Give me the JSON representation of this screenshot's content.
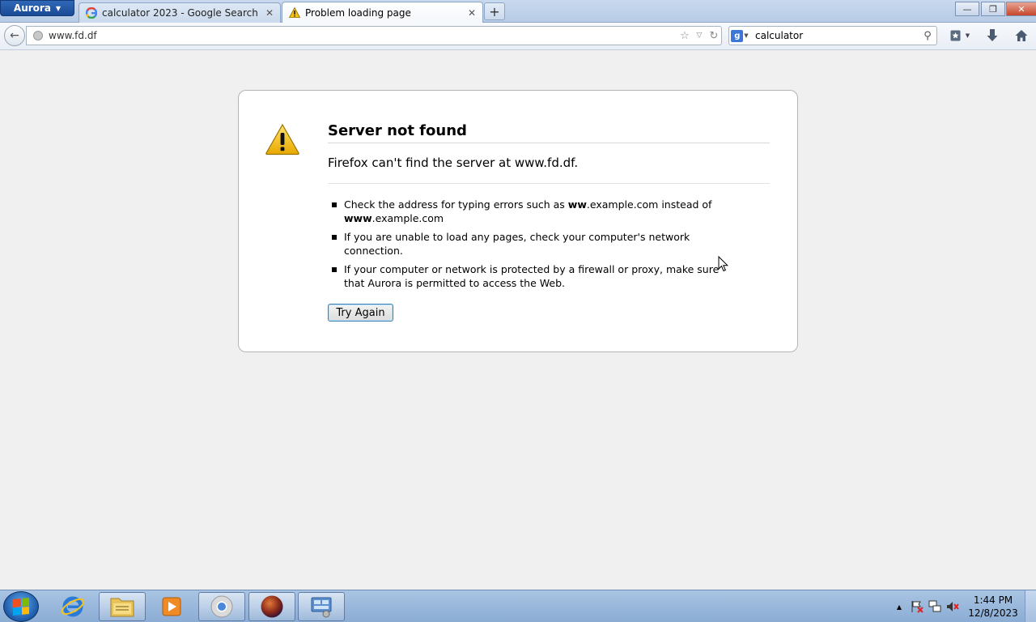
{
  "app": {
    "menu_label": "Aurora",
    "window_controls": {
      "minimize": "—",
      "restore": "❐",
      "close": "✕"
    }
  },
  "tabs": [
    {
      "title": "calculator 2023 - Google Search",
      "icon": "google-icon",
      "active": false
    },
    {
      "title": "Problem loading page",
      "icon": "warning-icon",
      "active": true
    }
  ],
  "new_tab_label": "+",
  "navbar": {
    "url": "www.fd.df",
    "search_value": "calculator"
  },
  "error": {
    "title": "Server not found",
    "description": "Firefox can't find the server at www.fd.df.",
    "bullets": {
      "b1_pre": "Check the address for typing errors such as ",
      "b1_bold1": "ww",
      "b1_mid": ".example.com instead of ",
      "b1_bold2": "www",
      "b1_post": ".example.com",
      "b2": "If you are unable to load any pages, check your computer's network connection.",
      "b3": "If your computer or network is protected by a firewall or proxy, make sure that Aurora is permitted to access the Web."
    },
    "try_again_label": "Try Again"
  },
  "taskbar": {
    "items": [
      "internet-explorer-icon",
      "file-explorer-icon",
      "media-player-icon",
      "chrome-icon",
      "firefox-aurora-icon",
      "control-panel-icon"
    ],
    "clock": {
      "time": "1:44 PM",
      "date": "12/8/2023"
    }
  },
  "colors": {
    "accent": "#3c7fb1",
    "warning_yellow": "#f4c20d",
    "page_bg": "#f0f0f0"
  }
}
